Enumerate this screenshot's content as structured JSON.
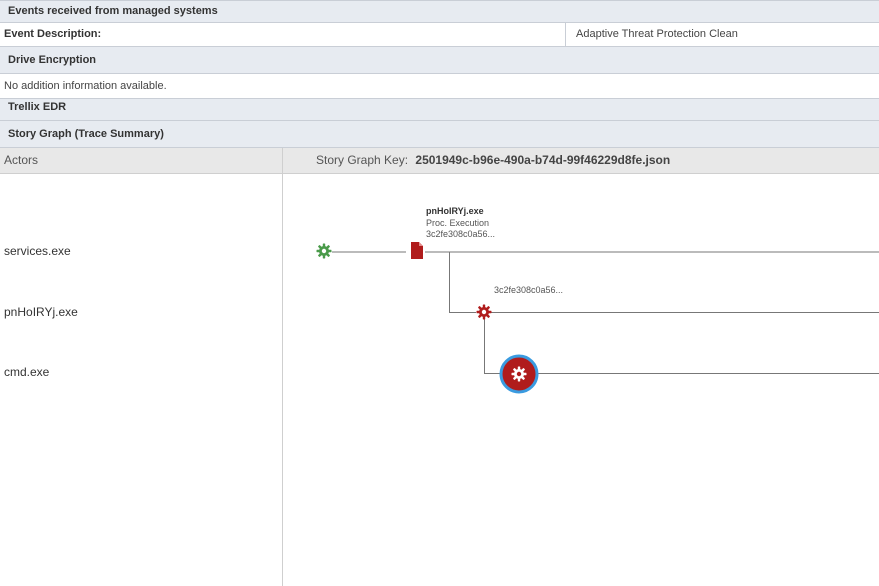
{
  "sections": {
    "events_title": "Events received from managed systems",
    "drive_encryption": "Drive Encryption",
    "trellix_edr": "Trellix EDR",
    "story_graph": "Story Graph (Trace Summary)"
  },
  "event_row": {
    "label": "Event Description:",
    "value": "Adaptive Threat Protection Clean"
  },
  "drive_row": {
    "text": "No addition information available."
  },
  "graph": {
    "actors_header": "Actors",
    "key_label": "Story Graph Key:",
    "key_value": "2501949c-b96e-490a-b74d-99f46229d8fe.json",
    "actors": [
      "services.exe",
      "pnHoIRYj.exe",
      "cmd.exe"
    ],
    "file_node": {
      "name": "pnHoIRYj.exe",
      "action": "Proc. Execution",
      "hash": "3c2fe308c0a56..."
    },
    "process_node_hash": "3c2fe308c0a56...",
    "colors": {
      "clean_green": "#4a9a4a",
      "threat_red": "#b01c1c",
      "highlight_blue": "#3a9be0",
      "line": "#777777"
    },
    "icons": [
      "gear-icon",
      "file-icon",
      "gear-icon",
      "gear-icon"
    ]
  }
}
